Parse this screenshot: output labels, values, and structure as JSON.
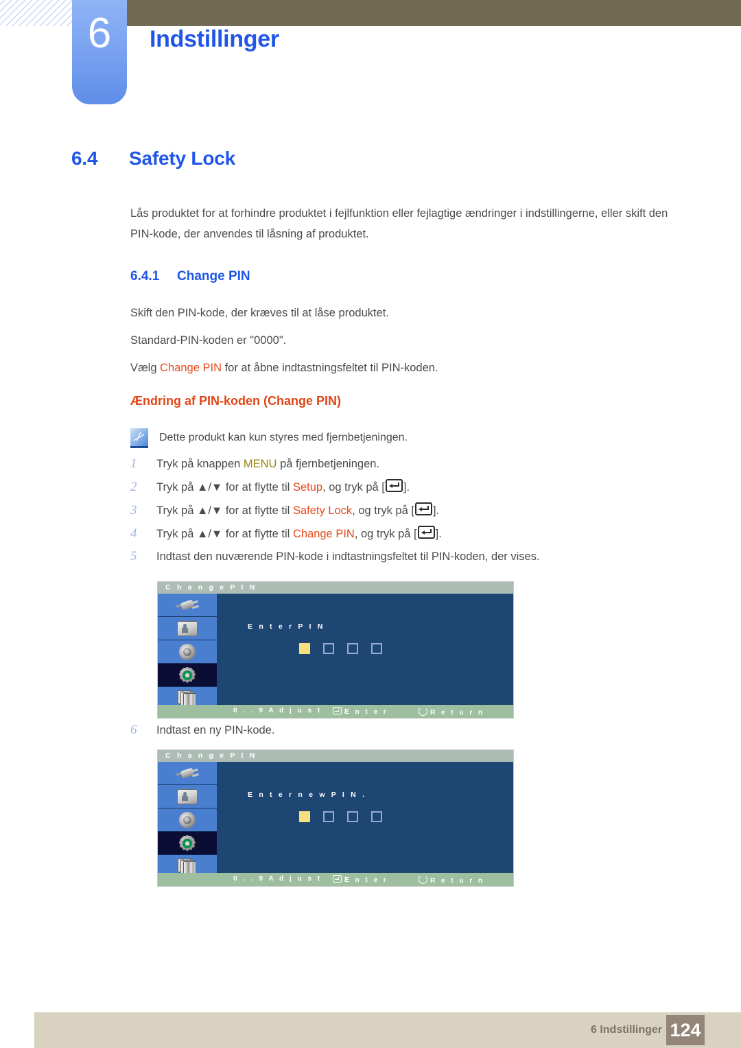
{
  "header": {
    "chapter_number": "6",
    "chapter_title": "Indstillinger"
  },
  "section": {
    "number": "6.4",
    "title": "Safety Lock",
    "intro": "Lås produktet for at forhindre produktet i fejlfunktion eller fejlagtige ændringer i indstillingerne, eller skift den PIN-kode, der anvendes til låsning af produktet."
  },
  "subsection": {
    "number": "6.4.1",
    "title": "Change PIN",
    "line1": "Skift den PIN-kode, der kræves til at låse produktet.",
    "line2": "Standard-PIN-koden er \"0000\".",
    "line3_pre": "Vælg ",
    "line3_kw": "Change PIN",
    "line3_post": " for at åbne indtastningsfeltet til PIN-koden."
  },
  "group": {
    "heading": "Ændring af PIN-koden (Change PIN)",
    "note_icon": "note-pencil-icon",
    "note": "Dette produkt kan kun styres med fjernbetjeningen."
  },
  "steps": [
    {
      "num": "1",
      "pre": "Tryk på knappen ",
      "kw": "MENU",
      "kw_type": "menu",
      "post": " på fjernbetjeningen.",
      "has_enter": false
    },
    {
      "num": "2",
      "pre": "Tryk på ▲/▼ for at flytte til ",
      "kw": "Setup",
      "kw_type": "orange",
      "post": ", og tryk på [",
      "tail": "].",
      "has_enter": true
    },
    {
      "num": "3",
      "pre": "Tryk på ▲/▼ for at flytte til ",
      "kw": "Safety Lock",
      "kw_type": "orange",
      "post": ", og tryk på [",
      "tail": "].",
      "has_enter": true
    },
    {
      "num": "4",
      "pre": "Tryk på ▲/▼ for at flytte til ",
      "kw": "Change PIN",
      "kw_type": "orange",
      "post": ", og tryk på [",
      "tail": "].",
      "has_enter": true
    },
    {
      "num": "5",
      "pre": "Indtast den nuværende PIN-kode i indtastningsfeltet til PIN-koden, der vises.",
      "kw": "",
      "kw_type": "none",
      "post": "",
      "has_enter": false
    }
  ],
  "step6": {
    "num": "6",
    "text": "Indtast en ny PIN-kode."
  },
  "osd_common": {
    "title": "C h a n g e   P I N",
    "sidebar_icons": [
      "input-plug-icon",
      "picture-screen-icon",
      "sound-speaker-icon",
      "setup-gear-icon",
      "multi-display-icon"
    ],
    "selected_sidebar_index": 3,
    "footer_adjust": "0 . . 9   A d j u s t",
    "footer_enter": "E n t e r",
    "footer_return": "R e t u r n",
    "pin_slots": [
      {
        "state": "filled"
      },
      {
        "state": "empty"
      },
      {
        "state": "empty"
      },
      {
        "state": "empty"
      }
    ],
    "colors": {
      "osd_background": "#1d4672",
      "osd_titlebar": "#adbdb5",
      "osd_sidebar": "#4a7fd0",
      "osd_sidebar_selected": "#0b0d35",
      "osd_footer": "#9dbf9f",
      "pin_filled": "#f7e081"
    }
  },
  "osd_screens": [
    {
      "prompt": "E n t e r   P I N"
    },
    {
      "prompt": "E n t e r   n e w   P I N ."
    }
  ],
  "footer": {
    "label": "6 Indstillinger",
    "page": "124"
  },
  "theme": {
    "heading_blue": "#1f56e8",
    "keyword_orange": "#e8491a",
    "keyword_menu": "#9a8410",
    "header_olive": "#706b52",
    "footer_beige": "#d9d2c0",
    "footer_page_box": "#938678"
  }
}
